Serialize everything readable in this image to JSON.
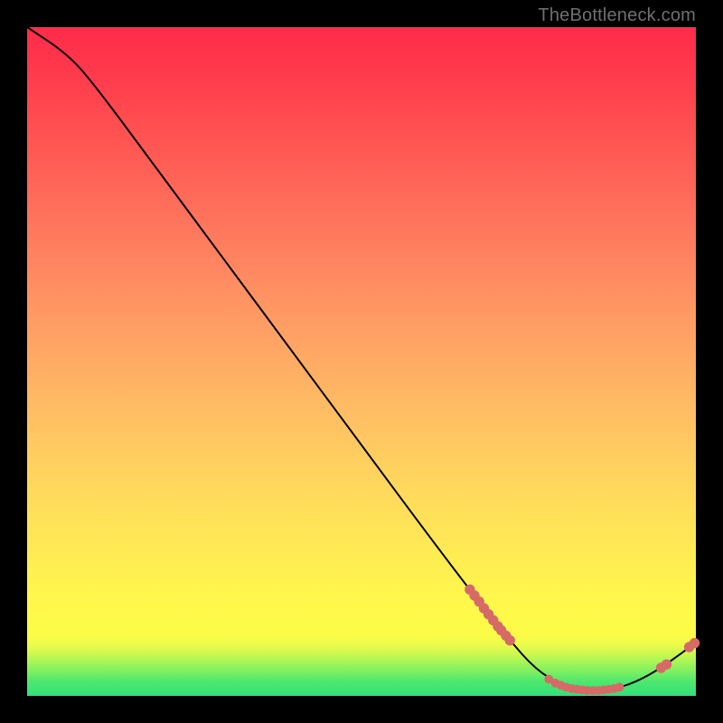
{
  "watermark": "TheBottleneck.com",
  "chart_data": {
    "type": "line",
    "title": "",
    "xlabel": "",
    "ylabel": "",
    "xlim": [
      0,
      100
    ],
    "ylim": [
      0,
      100
    ],
    "grid": false,
    "legend": false,
    "series": [
      {
        "name": "curve",
        "kind": "line",
        "color": "#000000",
        "points": [
          {
            "x": 0,
            "y": 100
          },
          {
            "x": 6,
            "y": 96
          },
          {
            "x": 10,
            "y": 91.5
          },
          {
            "x": 20,
            "y": 78
          },
          {
            "x": 30,
            "y": 64.5
          },
          {
            "x": 40,
            "y": 51
          },
          {
            "x": 50,
            "y": 37.5
          },
          {
            "x": 60,
            "y": 24
          },
          {
            "x": 68,
            "y": 13.5
          },
          {
            "x": 72,
            "y": 8.5
          },
          {
            "x": 76,
            "y": 4
          },
          {
            "x": 80,
            "y": 1.5
          },
          {
            "x": 84,
            "y": 0.8
          },
          {
            "x": 88,
            "y": 1
          },
          {
            "x": 92,
            "y": 2.5
          },
          {
            "x": 96,
            "y": 5
          },
          {
            "x": 100,
            "y": 8
          }
        ]
      },
      {
        "name": "descent-markers",
        "kind": "scatter",
        "color": "#d66a67",
        "r": 5.2,
        "points": [
          {
            "x": 66.2,
            "y": 15.9
          },
          {
            "x": 66.9,
            "y": 15.0
          },
          {
            "x": 67.6,
            "y": 14.1
          },
          {
            "x": 68.3,
            "y": 13.1
          },
          {
            "x": 69.0,
            "y": 12.2
          },
          {
            "x": 69.7,
            "y": 11.3
          },
          {
            "x": 70.4,
            "y": 10.4
          },
          {
            "x": 70.9,
            "y": 9.8
          },
          {
            "x": 71.6,
            "y": 9.0
          },
          {
            "x": 72.2,
            "y": 8.3
          }
        ]
      },
      {
        "name": "valley-markers",
        "kind": "scatter",
        "color": "#d66a67",
        "r": 4.4,
        "points": [
          {
            "x": 78.0,
            "y": 2.5
          },
          {
            "x": 79.0,
            "y": 1.9
          },
          {
            "x": 79.8,
            "y": 1.6
          },
          {
            "x": 80.6,
            "y": 1.3
          },
          {
            "x": 81.4,
            "y": 1.1
          },
          {
            "x": 82.2,
            "y": 1.0
          },
          {
            "x": 83.0,
            "y": 0.9
          },
          {
            "x": 83.8,
            "y": 0.8
          },
          {
            "x": 84.6,
            "y": 0.8
          },
          {
            "x": 85.4,
            "y": 0.8
          },
          {
            "x": 86.2,
            "y": 0.9
          },
          {
            "x": 87.0,
            "y": 1.0
          },
          {
            "x": 87.8,
            "y": 1.1
          },
          {
            "x": 88.6,
            "y": 1.3
          }
        ]
      },
      {
        "name": "ascent-markers",
        "kind": "scatter",
        "color": "#d66a67",
        "r": 5.2,
        "points": [
          {
            "x": 94.8,
            "y": 4.2
          },
          {
            "x": 95.6,
            "y": 4.7
          },
          {
            "x": 99.0,
            "y": 7.3
          },
          {
            "x": 99.8,
            "y": 7.9
          }
        ]
      }
    ]
  }
}
